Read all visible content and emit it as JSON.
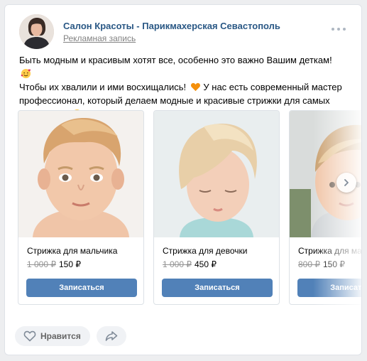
{
  "post": {
    "author": "Салон Красоты - Парикмахерская Севастополь",
    "ad_label": "Рекламная запись",
    "text_lines": [
      "Быть модным и красивым хотят все, особенно это важно Вашим деткам!",
      "Чтобы их хвалили и ими восхищались!",
      " У нас есть современный мастер профессионал, который делаем модные и красивые стрижки для самых маленьких!"
    ],
    "icons": {
      "more": "more-dots-icon",
      "emoji_1": "smiling-face-with-hearts-emoji",
      "emoji_2": "orange-heart-emoji",
      "emoji_3": "blushing-face-emoji",
      "next": "chevron-right-icon",
      "like": "heart-icon",
      "share": "share-arrow-icon"
    }
  },
  "cards": [
    {
      "title": "Стрижка для мальчика",
      "old_price": "1 000 ₽",
      "price": "150 ₽",
      "button": "Записаться"
    },
    {
      "title": "Стрижка для девочки",
      "old_price": "1 000 ₽",
      "price": "450 ₽",
      "button": "Записаться"
    },
    {
      "title": "Стрижка для мальчика",
      "old_price": "800 ₽",
      "price": "150 ₽",
      "button": "Записаться"
    }
  ],
  "actions": {
    "like_label": "Нравится"
  },
  "colors": {
    "link": "#2a5885",
    "button": "#5181b8",
    "background": "#edeef0"
  }
}
